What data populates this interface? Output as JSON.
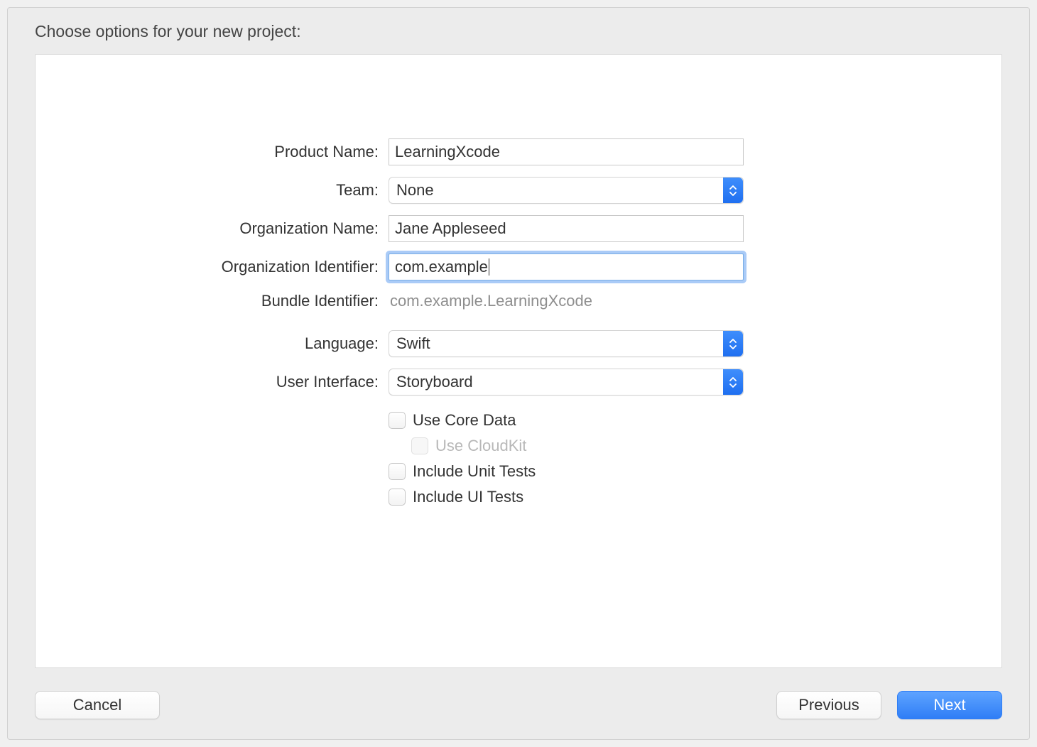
{
  "dialog": {
    "title": "Choose options for your new project:"
  },
  "form": {
    "productName": {
      "label": "Product Name:",
      "value": "LearningXcode"
    },
    "team": {
      "label": "Team:",
      "value": "None"
    },
    "organizationName": {
      "label": "Organization Name:",
      "value": "Jane Appleseed"
    },
    "organizationIdentifier": {
      "label": "Organization Identifier:",
      "value": "com.example"
    },
    "bundleIdentifier": {
      "label": "Bundle Identifier:",
      "value": "com.example.LearningXcode"
    },
    "language": {
      "label": "Language:",
      "value": "Swift"
    },
    "userInterface": {
      "label": "User Interface:",
      "value": "Storyboard"
    },
    "useCoreData": {
      "label": "Use Core Data",
      "checked": false
    },
    "useCloudKit": {
      "label": "Use CloudKit",
      "checked": false,
      "disabled": true
    },
    "includeUnitTests": {
      "label": "Include Unit Tests",
      "checked": false
    },
    "includeUITests": {
      "label": "Include UI Tests",
      "checked": false
    }
  },
  "buttons": {
    "cancel": "Cancel",
    "previous": "Previous",
    "next": "Next"
  }
}
